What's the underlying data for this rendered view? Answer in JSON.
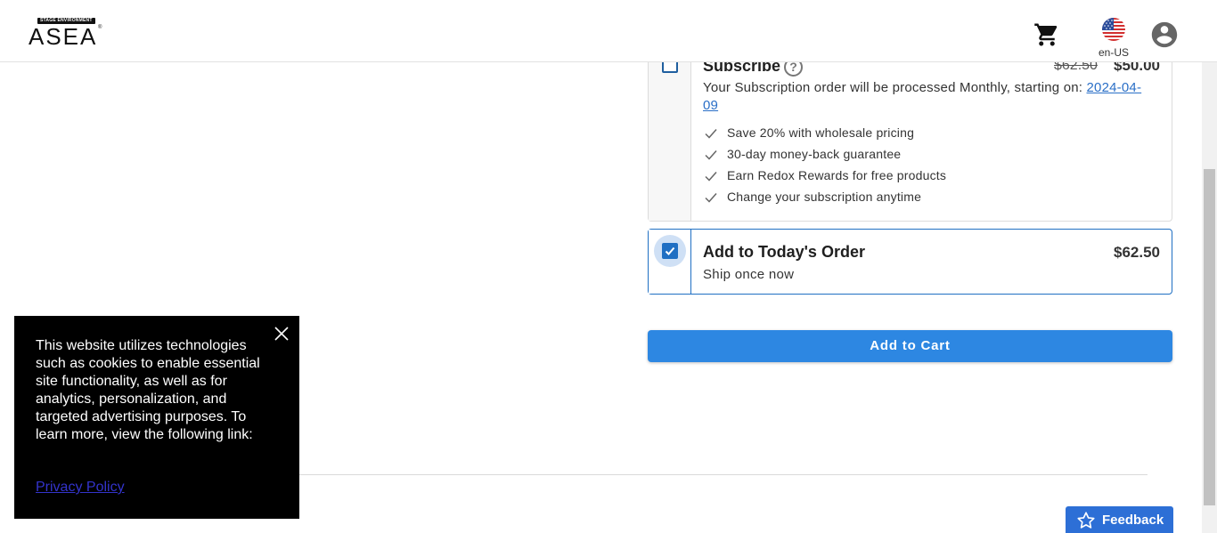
{
  "header": {
    "logo_badge": "STAGE ENVIRONMENT",
    "logo_text": "ASEA",
    "locale_label": "en-US"
  },
  "subscribe_option": {
    "title": "Subscribe",
    "help_symbol": "?",
    "original_price": "$62.50",
    "price": "$50.00",
    "description_prefix": "Your Subscription order will be processed Monthly, starting on: ",
    "start_date": "2024-04-09",
    "checked": false,
    "benefits": [
      "Save 20% with wholesale pricing",
      "30-day money-back guarantee",
      "Earn Redox Rewards for free products",
      "Change your subscription anytime"
    ]
  },
  "today_option": {
    "title": "Add to Today's Order",
    "subtitle": "Ship once now",
    "price": "$62.50",
    "checked": true
  },
  "add_to_cart_label": "Add to Cart",
  "cookie_banner": {
    "text": "This website utilizes technologies such as cookies to enable essential site functionality, as well as for analytics, personalization, and targeted advertising purposes. To learn more, view the following link:",
    "link_label": "Privacy Policy"
  },
  "feedback_label": "Feedback",
  "colors": {
    "primary_button": "#2d87e2",
    "selected_border": "#1f6fc3",
    "feedback_tab": "#2d6fd6",
    "cookie_bg": "#000000"
  },
  "icons": [
    "cart-icon",
    "us-flag-icon",
    "account-icon",
    "help-icon",
    "checkmark-icon",
    "close-icon",
    "star-icon"
  ]
}
